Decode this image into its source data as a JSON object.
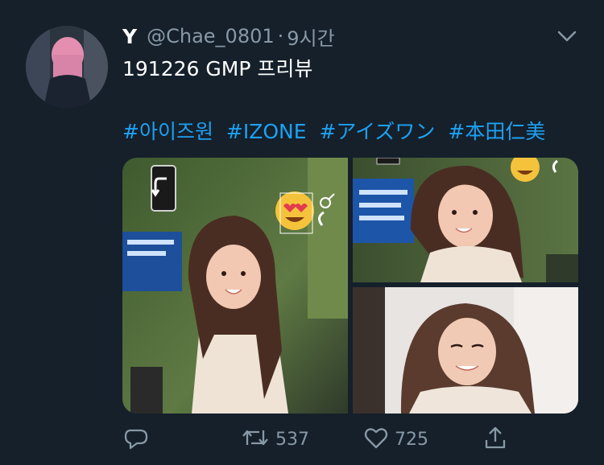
{
  "tweet": {
    "display_name": "Y",
    "handle": "@Chae_0801",
    "separator": "·",
    "time": "9시간",
    "text_line1": "191226 GMP 프리뷰",
    "hashtags": [
      "#아이즈원",
      "#IZONE",
      "#アイズワン",
      "#本田仁美"
    ]
  },
  "actions": {
    "reply_count": "",
    "retweet_count": "537",
    "like_count": "725"
  },
  "colors": {
    "background": "#15202b",
    "secondary_text": "#8899a6",
    "link": "#1da1f2"
  },
  "icons": [
    "chevron-down-icon",
    "reply-icon",
    "retweet-icon",
    "heart-icon",
    "share-icon"
  ]
}
